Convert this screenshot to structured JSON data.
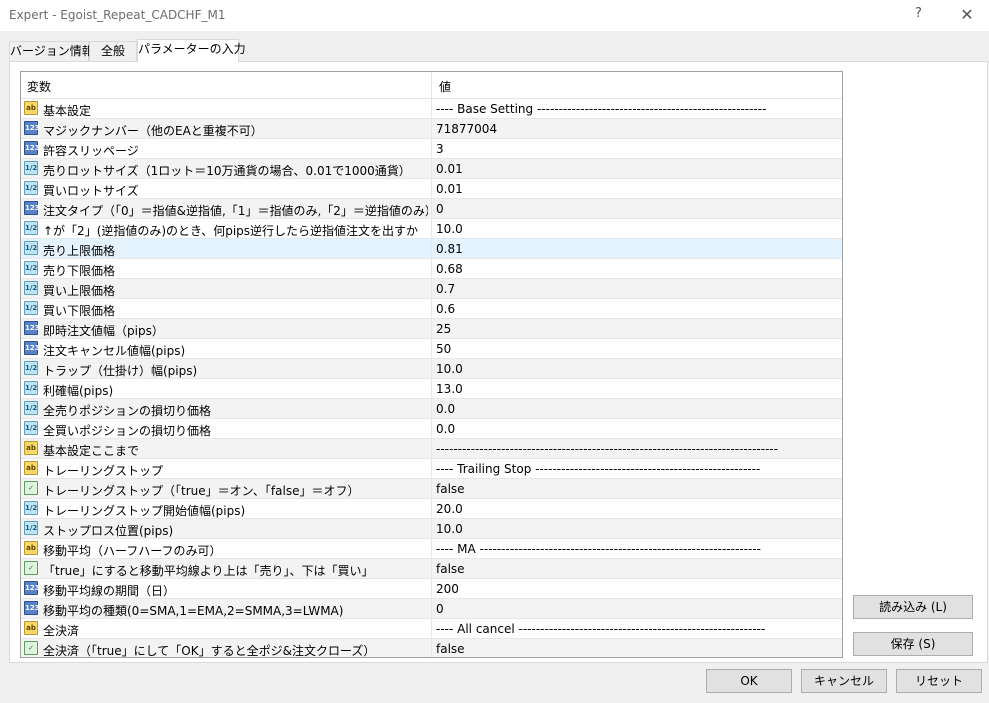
{
  "window": {
    "title": "Expert - Egoist_Repeat_CADCHF_M1",
    "help_glyph": "?",
    "close_glyph": "✕"
  },
  "tabs": [
    {
      "label": "バージョン情報"
    },
    {
      "label": "全般"
    },
    {
      "label": "パラメーターの入力"
    }
  ],
  "grid": {
    "col_variable": "変数",
    "col_value": "値",
    "selected_row": 7,
    "rows": [
      {
        "type": "string",
        "icon": "ab",
        "name": "基本設定",
        "value": "---- Base Setting -----------------------------------------------------"
      },
      {
        "type": "int",
        "icon": "123",
        "name": "マジックナンバー（他のEAと重複不可）",
        "value": "71877004"
      },
      {
        "type": "int",
        "icon": "123",
        "name": "許容スリッページ",
        "value": "3"
      },
      {
        "type": "double",
        "icon": "1/2",
        "name": "売りロットサイズ（1ロット＝10万通貨の場合、0.01で1000通貨）",
        "value": "0.01"
      },
      {
        "type": "double",
        "icon": "1/2",
        "name": "買いロットサイズ",
        "value": "0.01"
      },
      {
        "type": "int",
        "icon": "123",
        "name": "注文タイプ（「0」＝指値&逆指値,「1」＝指値のみ,「2」＝逆指値のみ）",
        "value": "0"
      },
      {
        "type": "double",
        "icon": "1/2",
        "name": "↑が「2」(逆指値のみ)のとき、何pips逆行したら逆指値注文を出すか",
        "value": "10.0"
      },
      {
        "type": "double",
        "icon": "1/2",
        "name": "売り上限価格",
        "value": "0.81"
      },
      {
        "type": "double",
        "icon": "1/2",
        "name": "売り下限価格",
        "value": "0.68"
      },
      {
        "type": "double",
        "icon": "1/2",
        "name": "買い上限価格",
        "value": "0.7"
      },
      {
        "type": "double",
        "icon": "1/2",
        "name": "買い下限価格",
        "value": "0.6"
      },
      {
        "type": "int",
        "icon": "123",
        "name": "即時注文値幅（pips）",
        "value": "25"
      },
      {
        "type": "int",
        "icon": "123",
        "name": "注文キャンセル値幅(pips)",
        "value": "50"
      },
      {
        "type": "double",
        "icon": "1/2",
        "name": "トラップ（仕掛け）幅(pips)",
        "value": "10.0"
      },
      {
        "type": "double",
        "icon": "1/2",
        "name": "利確幅(pips)",
        "value": "13.0"
      },
      {
        "type": "double",
        "icon": "1/2",
        "name": "全売りポジションの損切り価格",
        "value": "0.0"
      },
      {
        "type": "double",
        "icon": "1/2",
        "name": "全買いポジションの損切り価格",
        "value": "0.0"
      },
      {
        "type": "string",
        "icon": "ab",
        "name": "基本設定ここまで",
        "value": "-------------------------------------------------------------------------------"
      },
      {
        "type": "string",
        "icon": "ab",
        "name": "トレーリングストップ",
        "value": "---- Trailing Stop ----------------------------------------------------"
      },
      {
        "type": "bool",
        "icon": "✓",
        "name": "トレーリングストップ（「true」＝オン、「false」＝オフ）",
        "value": "false"
      },
      {
        "type": "double",
        "icon": "1/2",
        "name": "トレーリングストップ開始値幅(pips)",
        "value": "20.0"
      },
      {
        "type": "double",
        "icon": "1/2",
        "name": "ストップロス位置(pips)",
        "value": "10.0"
      },
      {
        "type": "string",
        "icon": "ab",
        "name": "移動平均（ハーフハーフのみ可）",
        "value": "---- MA -----------------------------------------------------------------"
      },
      {
        "type": "bool",
        "icon": "✓",
        "name": "「true」にすると移動平均線より上は「売り」、下は「買い」",
        "value": "false"
      },
      {
        "type": "int",
        "icon": "123",
        "name": "移動平均線の期間（日）",
        "value": "200"
      },
      {
        "type": "int",
        "icon": "123",
        "name": "移動平均の種類(0=SMA,1=EMA,2=SMMA,3=LWMA)",
        "value": "0"
      },
      {
        "type": "string",
        "icon": "ab",
        "name": "全決済",
        "value": "---- All cancel ---------------------------------------------------------"
      },
      {
        "type": "bool",
        "icon": "✓",
        "name": "全決済（「true」にして「OK」すると全ポジ&注文クローズ）",
        "value": "false"
      }
    ]
  },
  "side_buttons": {
    "load": "読み込み (L)",
    "save": "保存 (S)"
  },
  "footer_buttons": {
    "ok": "OK",
    "cancel": "キャンセル",
    "reset": "リセット"
  },
  "colors": {
    "selected_row": "#e5f3ff",
    "string_icon": "#f7d96b",
    "int_icon": "#5a82c9",
    "double_icon": "#bfe4f4",
    "bool_icon": "#dff2df"
  }
}
